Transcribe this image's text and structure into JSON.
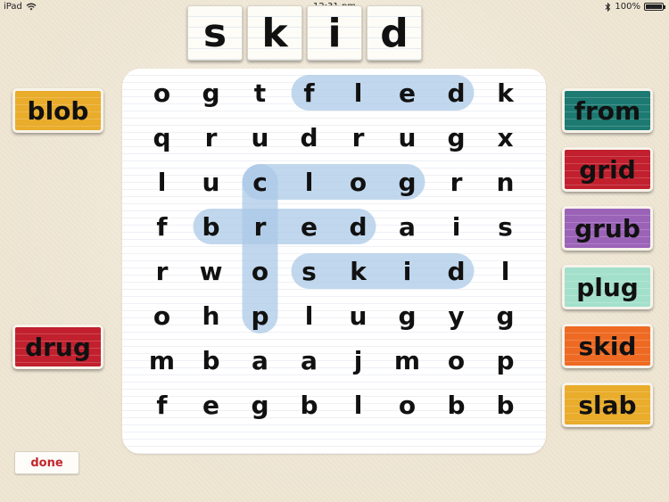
{
  "status_bar": {
    "device": "iPad",
    "time": "12:31 pm",
    "battery": "100%",
    "battery_level": 1.0
  },
  "target_word": [
    "s",
    "k",
    "i",
    "d"
  ],
  "grid": [
    [
      "o",
      "g",
      "t",
      "f",
      "l",
      "e",
      "d",
      "k"
    ],
    [
      "q",
      "r",
      "u",
      "d",
      "r",
      "u",
      "g",
      "x"
    ],
    [
      "l",
      "u",
      "c",
      "l",
      "o",
      "g",
      "r",
      "n"
    ],
    [
      "f",
      "b",
      "r",
      "e",
      "d",
      "a",
      "i",
      "s"
    ],
    [
      "r",
      "w",
      "o",
      "s",
      "k",
      "i",
      "d",
      "l"
    ],
    [
      "o",
      "h",
      "p",
      "l",
      "u",
      "g",
      "y",
      "g"
    ],
    [
      "m",
      "b",
      "a",
      "a",
      "j",
      "m",
      "o",
      "p"
    ],
    [
      "f",
      "e",
      "g",
      "b",
      "l",
      "o",
      "b",
      "b"
    ]
  ],
  "found_words": [
    {
      "word": "fled",
      "row_start": 0,
      "col_start": 3,
      "row_end": 0,
      "col_end": 6
    },
    {
      "word": "clog",
      "row_start": 2,
      "col_start": 2,
      "row_end": 2,
      "col_end": 5
    },
    {
      "word": "bred",
      "row_start": 3,
      "col_start": 1,
      "row_end": 3,
      "col_end": 4
    },
    {
      "word": "skid",
      "row_start": 4,
      "col_start": 3,
      "row_end": 4,
      "col_end": 6
    },
    {
      "word": "crop",
      "row_start": 2,
      "col_start": 2,
      "row_end": 5,
      "col_end": 2
    }
  ],
  "left_words": [
    {
      "label": "blob",
      "color": "#e9ac2b"
    },
    {
      "label": "drug",
      "color": "#c2202e"
    }
  ],
  "right_words": [
    {
      "label": "from",
      "color": "#1d7a72"
    },
    {
      "label": "grid",
      "color": "#c2202e"
    },
    {
      "label": "grub",
      "color": "#9b63b8"
    },
    {
      "label": "plug",
      "color": "#a3e0cc"
    },
    {
      "label": "skid",
      "color": "#ee6a23"
    },
    {
      "label": "slab",
      "color": "#e9ac2b"
    }
  ],
  "done_label": "done",
  "highlight_color": "#a9c8e6"
}
